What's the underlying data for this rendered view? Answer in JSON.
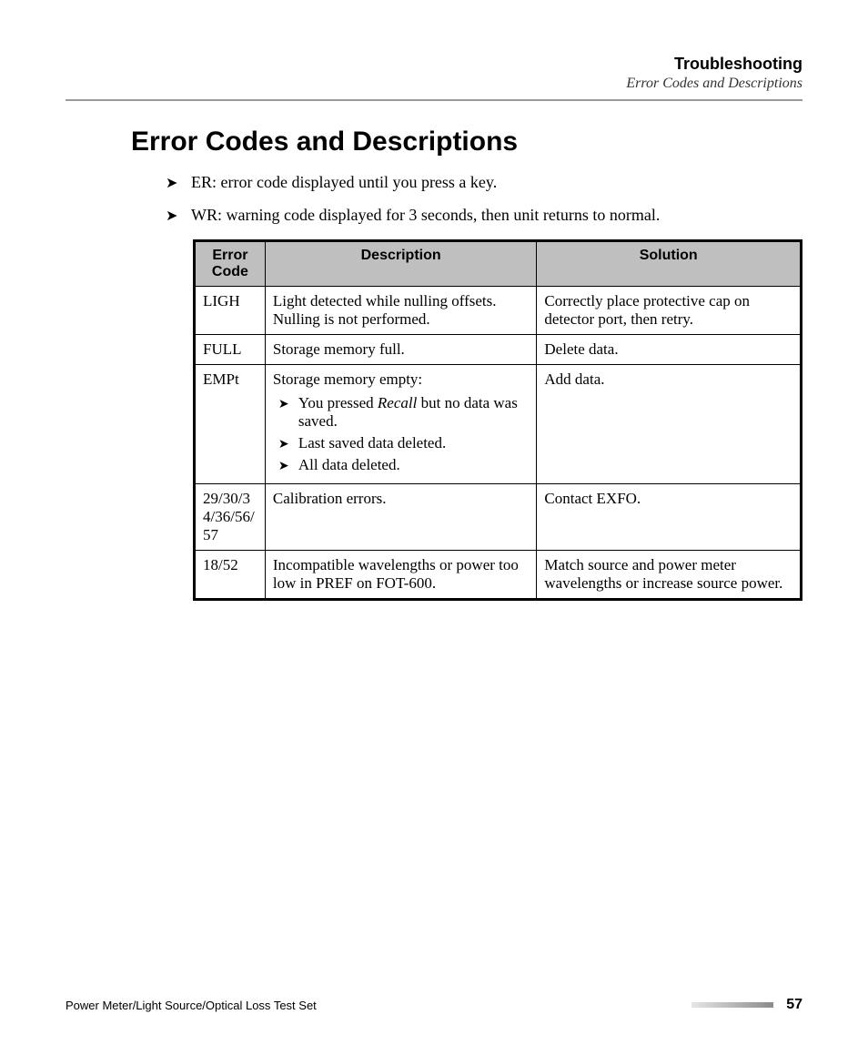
{
  "header": {
    "title": "Troubleshooting",
    "subtitle": "Error Codes and Descriptions"
  },
  "section_title": "Error Codes and Descriptions",
  "intro": [
    "ER: error code displayed until you press a key.",
    "WR: warning code displayed for 3 seconds, then unit returns to normal."
  ],
  "table": {
    "headers": [
      "Error Code",
      "Description",
      "Solution"
    ],
    "rows": [
      {
        "code": "LIGH",
        "description": "Light detected while nulling offsets. Nulling is not performed.",
        "solution": "Correctly place protective cap on detector port, then retry."
      },
      {
        "code": "FULL",
        "description": "Storage memory full.",
        "solution": "Delete data."
      },
      {
        "code": "EMPt",
        "description_lead": "Storage memory empty:",
        "description_items": [
          {
            "pre": "You pressed ",
            "em": "Recall",
            "post": " but no data was saved."
          },
          {
            "pre": "Last saved data deleted.",
            "em": "",
            "post": ""
          },
          {
            "pre": "All data deleted.",
            "em": "",
            "post": ""
          }
        ],
        "solution": "Add data."
      },
      {
        "code": "29/30/34/36/56/57",
        "description": "Calibration errors.",
        "solution": "Contact EXFO."
      },
      {
        "code": "18/52",
        "description": "Incompatible wavelengths or power too low in PREF on FOT-600.",
        "solution": "Match source and power meter wavelengths or increase source power."
      }
    ]
  },
  "footer": {
    "left": "Power Meter/Light Source/Optical Loss Test Set",
    "page": "57"
  },
  "glyphs": {
    "arrow": "➤"
  }
}
